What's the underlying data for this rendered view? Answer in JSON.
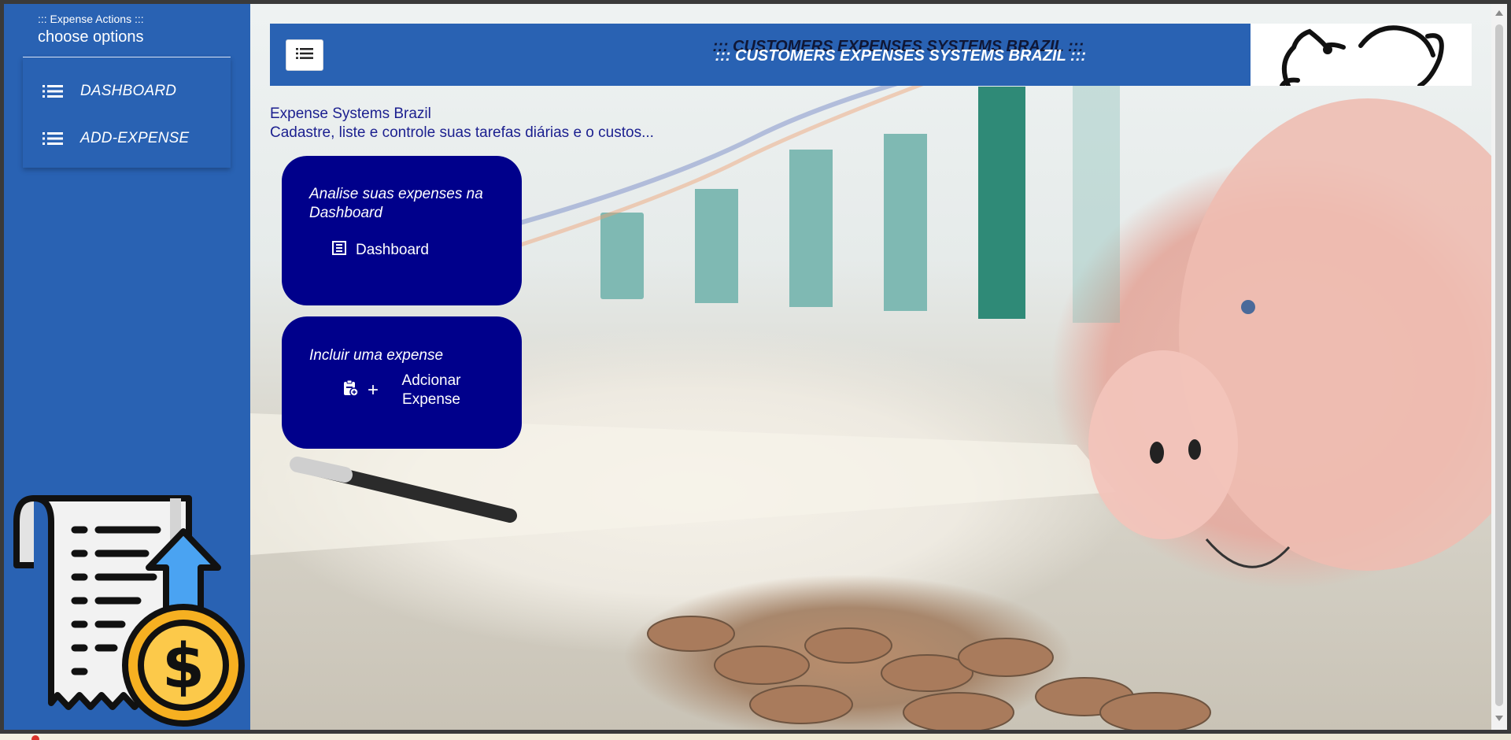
{
  "sidebar": {
    "kicker": "::: Expense Actions :::",
    "title": "choose options",
    "items": [
      {
        "label": "DASHBOARD",
        "icon": "list-icon"
      },
      {
        "label": "ADD-EXPENSE",
        "icon": "list-icon"
      }
    ]
  },
  "header": {
    "title": "::: CUSTOMERS EXPENSES SYSTEMS BRAZIL :::",
    "menu_icon": "list-icon"
  },
  "intro": {
    "line1": "Expense Systems Brazil",
    "line2": "Cadastre, liste e controle suas tarefas diárias e o custos..."
  },
  "cards": [
    {
      "title": "Analise suas expenses na Dashboard",
      "button_label": "Dashboard",
      "icon": "table-icon"
    },
    {
      "title": "Incluir uma expense",
      "button_label": "Adcionar Expense",
      "icon": "clipboard-add-icon"
    }
  ],
  "colors": {
    "sidebar": "#2962b3",
    "card": "#00008b",
    "intro_text": "#1b1f8f"
  }
}
